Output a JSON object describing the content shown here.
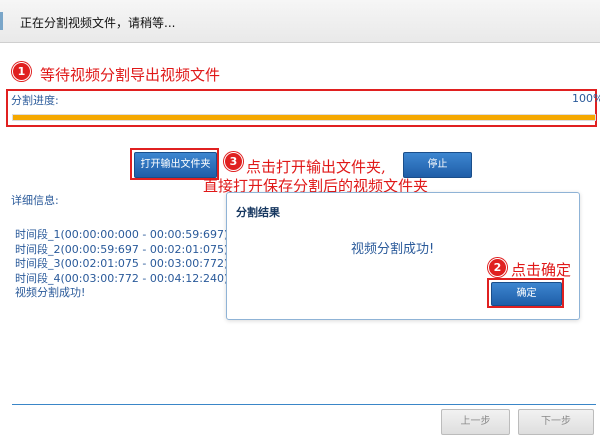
{
  "header": {
    "title": "正在分割视频文件，请稍等..."
  },
  "annotations": {
    "step1": {
      "badge": "1",
      "text": "等待视频分割导出视频文件"
    },
    "step2": {
      "badge": "2",
      "text": "点击确定"
    },
    "step3": {
      "badge": "3",
      "line1": "点击打开输出文件夹,",
      "line2": "直接打开保存分割后的视频文件夹"
    }
  },
  "progress": {
    "label": "分割进度:",
    "percent_text": "100%",
    "value": 1.0,
    "fill_color": "#f5a800"
  },
  "buttons": {
    "open_folder": "打开输出文件夹",
    "stop": "停止",
    "prev": "上一步",
    "next": "下一步"
  },
  "details": {
    "label": "详细信息:",
    "lines": [
      "时间段_1(00:00:00:000 - 00:00:59:697)",
      "时间段_2(00:00:59:697 - 00:02:01:075)",
      "时间段_3(00:02:01:075 - 00:03:00:772)",
      "时间段_4(00:03:00:772 - 00:04:12:240)",
      "视频分割成功!"
    ]
  },
  "dialog": {
    "title": "分割结果",
    "message": "视频分割成功!",
    "ok": "确定"
  },
  "colors": {
    "accent": "#1f5ea8",
    "annotation": "#e02020",
    "progress": "#f5a800"
  }
}
